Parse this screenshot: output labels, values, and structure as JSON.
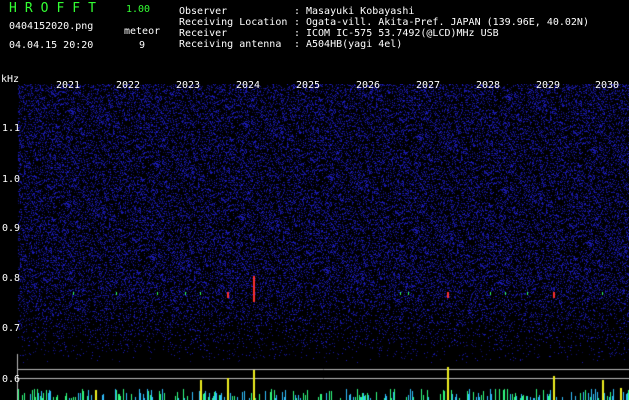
{
  "header": {
    "app_title": "HROFFT",
    "app_version": "1.00",
    "filename": "0404152020.png",
    "timestamp": "04.04.15 20:20",
    "meteor_label": "meteor",
    "meteor_count": "9"
  },
  "metadata": [
    {
      "key": "Observer",
      "value": "Masayuki Kobayashi"
    },
    {
      "key": "Receiving Location",
      "value": "Ogata-vill. Akita-Pref. JAPAN (139.96E, 40.02N)"
    },
    {
      "key": "Receiver",
      "value": "ICOM IC-575 53.7492(@LCD)MHz USB"
    },
    {
      "key": "Receiving antenna",
      "value": "A504HB(yagi 4el)"
    }
  ],
  "spectrogram": {
    "unit": "kHz",
    "x_ticks": [
      "2021",
      "2022",
      "2023",
      "2024",
      "2025",
      "2026",
      "2027",
      "2028",
      "2029",
      "2030"
    ],
    "y_ticks": [
      "1.1",
      "1.0",
      "0.9",
      "0.8",
      "0.7",
      "0.6"
    ],
    "colors": {
      "background": "#000000",
      "noise": "#1a1aa8",
      "echo_hot": "#ff3030",
      "echo_mid": "#30ff60",
      "bar": "#f0f020"
    }
  }
}
